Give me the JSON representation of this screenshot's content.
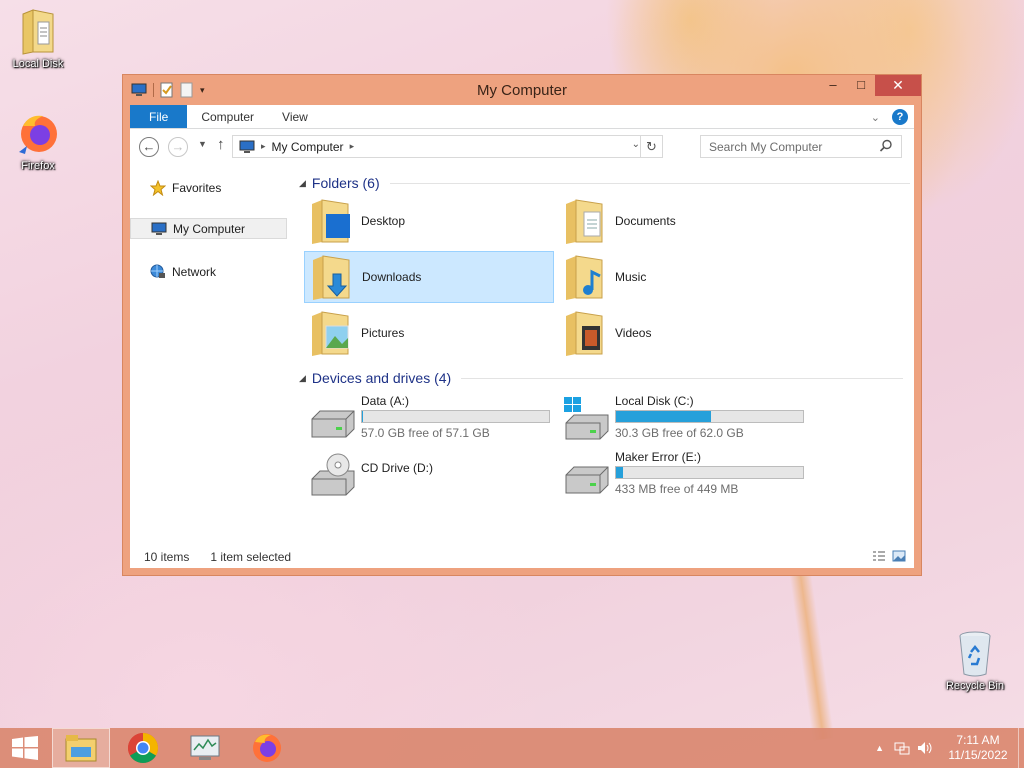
{
  "desktop": {
    "icons": [
      {
        "label": "Local Disk",
        "icon": "folder-icon"
      },
      {
        "label": "Firefox",
        "icon": "firefox-icon"
      },
      {
        "label": "Recycle Bin",
        "icon": "recycle-bin-icon"
      }
    ]
  },
  "window": {
    "title": "My Computer",
    "ribbon": {
      "tabs": [
        "File",
        "Computer",
        "View"
      ]
    },
    "address": {
      "path": "My Computer"
    },
    "search": {
      "placeholder": "Search My Computer"
    },
    "nav_pane": {
      "items": [
        "Favorites",
        "My Computer",
        "Network"
      ],
      "selected": "My Computer"
    },
    "folders": {
      "header": "Folders (6)",
      "items": [
        {
          "label": "Desktop"
        },
        {
          "label": "Documents"
        },
        {
          "label": "Downloads",
          "selected": true
        },
        {
          "label": "Music"
        },
        {
          "label": "Pictures"
        },
        {
          "label": "Videos"
        }
      ]
    },
    "drives": {
      "header": "Devices and drives (4)",
      "items": [
        {
          "name": "Data (A:)",
          "free": "57.0 GB free of 57.1 GB",
          "used_fraction": 0.002
        },
        {
          "name": "Local Disk (C:)",
          "free": "30.3 GB free of 62.0 GB",
          "used_fraction": 0.51
        },
        {
          "name": "CD Drive (D:)"
        },
        {
          "name": "Maker Error (E:)",
          "free": "433 MB free of 449 MB",
          "used_fraction": 0.036
        }
      ]
    },
    "status": {
      "items_count": "10 items",
      "selection": "1 item selected"
    }
  },
  "taskbar": {
    "apps": [
      "start",
      "file-explorer",
      "chrome",
      "task-manager",
      "firefox"
    ],
    "active": "file-explorer",
    "clock": {
      "time": "7:11 AM",
      "date": "11/15/2022"
    }
  },
  "colors": {
    "accent": "#1979ca",
    "window_frame": "#eea27f",
    "close": "#c7504a",
    "drive_bar": "#26a0da",
    "selection": "#cce8ff"
  }
}
